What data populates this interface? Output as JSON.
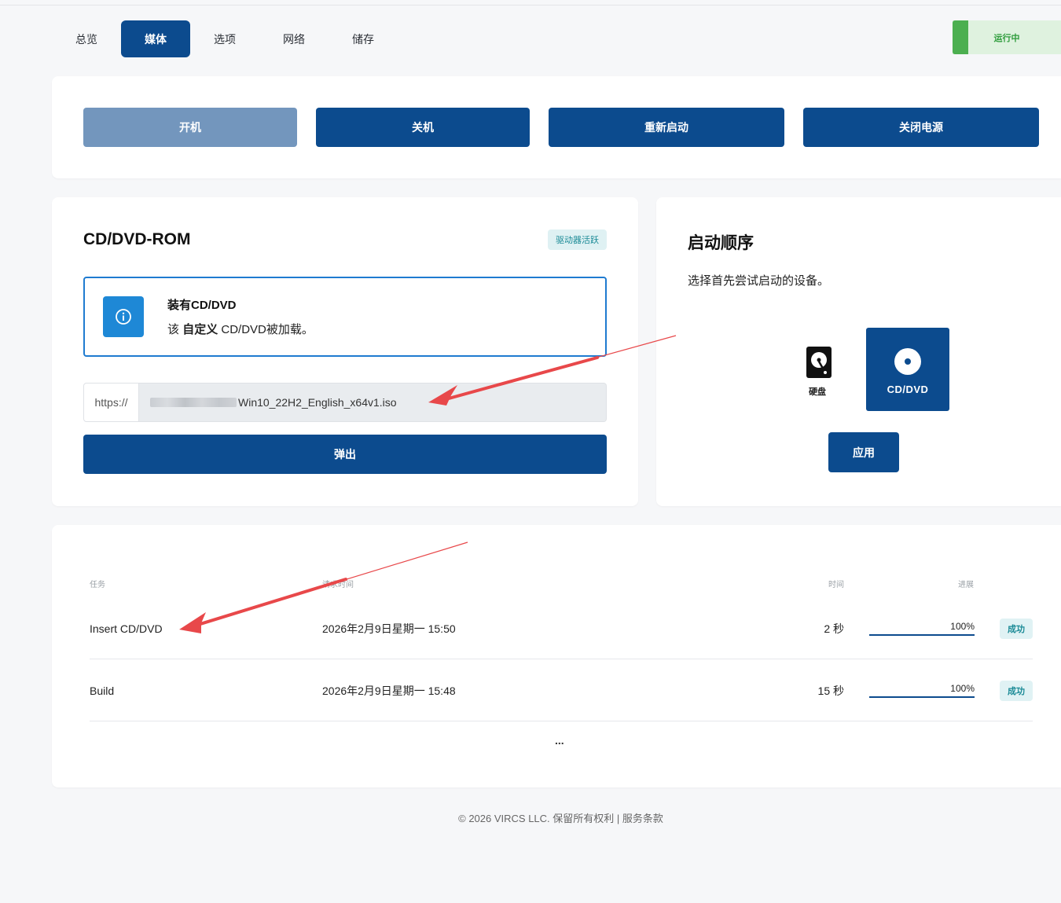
{
  "tabs": [
    "总览",
    "媒体",
    "选项",
    "网络",
    "储存"
  ],
  "active_tab": "媒体",
  "status": {
    "label": "运行中",
    "color": "#4caf50"
  },
  "power_buttons": {
    "start": "开机",
    "shutdown": "关机",
    "restart": "重新启动",
    "poweroff": "关闭电源"
  },
  "cdrom": {
    "title": "CD/DVD-ROM",
    "badge": "驱动器活跃",
    "info_title": "装有CD/DVD",
    "info_prefix": "该",
    "info_bold": "自定义",
    "info_suffix": "CD/DVD被加载。",
    "url_prefix": "https://",
    "url_visible": "Win10_22H2_English_x64v1.iso",
    "eject": "弹出"
  },
  "boot": {
    "title": "启动顺序",
    "description": "选择首先尝试启动的设备。",
    "hdd_label": "硬盘",
    "cd_label": "CD/DVD",
    "apply": "应用"
  },
  "tasks": {
    "headers": {
      "task": "任务",
      "requested": "请求时间",
      "time": "时间",
      "progress": "进展"
    },
    "rows": [
      {
        "task": "Insert CD/DVD",
        "requested": "2026年2月9日星期一 15:50",
        "time": "2 秒",
        "progress": "100%",
        "progress_value": 1.0,
        "status": "成功"
      },
      {
        "task": "Build",
        "requested": "2026年2月9日星期一 15:48",
        "time": "15 秒",
        "progress": "100%",
        "progress_value": 1.0,
        "status": "成功"
      }
    ],
    "more": "..."
  },
  "footer": "© 2026 VIRCS LLC. 保留所有权利 | 服务条款",
  "colors": {
    "primary": "#0c4b8e",
    "disabled": "#7396bd",
    "info": "#1e88d6",
    "success_bg": "#e0f2f4",
    "success_text": "#1a8a96",
    "annotation": "#e8484a"
  }
}
